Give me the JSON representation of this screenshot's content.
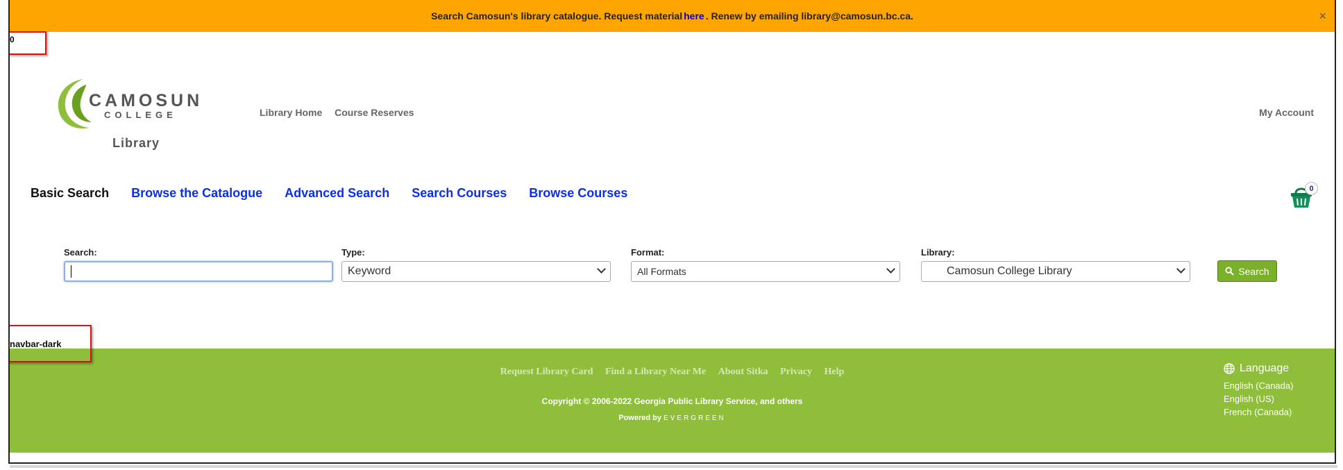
{
  "banner": {
    "text_before": "Search Camosun's library catalogue. Request material",
    "link": "here",
    "text_after": ". Renew by emailing library@camosun.bc.ca.",
    "close": "×"
  },
  "annotations": {
    "marker_zero": "0",
    "navbar_label": "navbar-dark"
  },
  "header": {
    "logo_name": "CAMOSUN",
    "logo_sub": "COLLEGE",
    "library_label": "Library",
    "nav": [
      "Library Home",
      "Course Reserves"
    ],
    "my_account": "My Account"
  },
  "tabs": [
    "Basic Search",
    "Browse the Catalogue",
    "Advanced Search",
    "Search Courses",
    "Browse Courses"
  ],
  "basket": {
    "count": "0"
  },
  "search": {
    "search_label": "Search:",
    "search_value": "",
    "type_label": "Type:",
    "type_value": "Keyword",
    "format_label": "Format:",
    "format_value": "All Formats",
    "library_label": "Library:",
    "library_value": "Camosun College Library",
    "button": "Search"
  },
  "footer": {
    "links": [
      "Request Library Card",
      "Find a Library Near Me",
      "About Sitka",
      "Privacy",
      "Help"
    ],
    "copyright": "Copyright © 2006-2022 Georgia Public Library Service, and others",
    "powered_by": "Powered by",
    "evergreen": "EVERGREEN",
    "language_title": "Language",
    "languages": [
      "English (Canada)",
      "English (US)",
      "French (Canada)"
    ]
  },
  "colors": {
    "banner": "#FFA500",
    "footer": "#8fbe3b",
    "link": "#0a2fe8",
    "button": "#7bb02a"
  }
}
